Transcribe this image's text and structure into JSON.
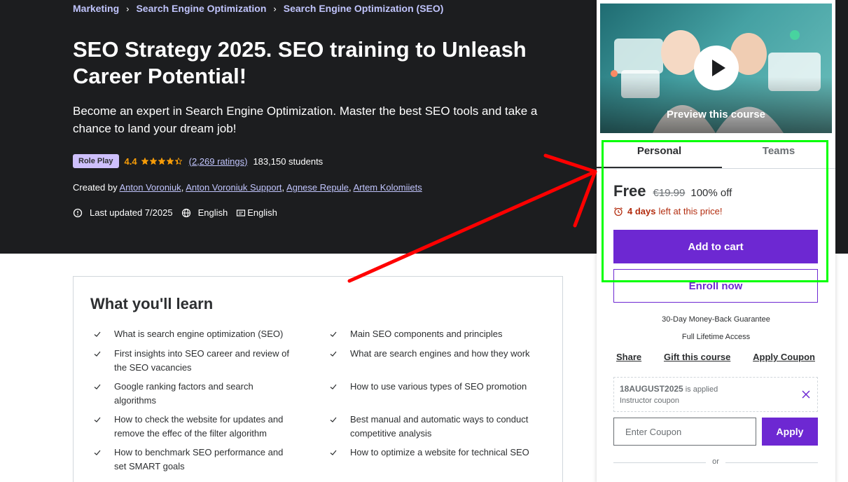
{
  "breadcrumb": [
    "Marketing",
    "Search Engine Optimization",
    "Search Engine Optimization (SEO)"
  ],
  "course": {
    "title": "SEO Strategy 2025. SEO training to Unleash Career Potential!",
    "subtitle": "Become an expert in Search Engine Optimization. Master the best SEO tools and take a chance to land your dream job!",
    "badge": "Role Play",
    "rating": "4.4",
    "stars_value": 4.4,
    "ratings_count": "(2,269 ratings)",
    "students": "183,150 students",
    "created_by_label": "Created by",
    "authors": [
      "Anton Voroniuk",
      "Anton Voroniuk Support",
      "Agnese Repule",
      "Artem Kolomiiets"
    ],
    "last_updated": "Last updated 7/2025",
    "language": "English",
    "captions": "English"
  },
  "learn": {
    "title": "What you'll learn",
    "left": [
      "What is search engine optimization (SEO)",
      "First insights into SEO career and review of the SEO vacancies",
      "Google ranking factors and search algorithms",
      "How to check the website for updates and remove the effec of the filter algorithm",
      "How to benchmark SEO performance and set SMART goals"
    ],
    "right": [
      "Main SEO components and principles",
      "What are search engines and how they work",
      "How to use various types of SEO promotion",
      "Best manual and automatic ways to conduct competitive analysis",
      "How to optimize a website for technical SEO"
    ]
  },
  "sidebar": {
    "preview_label": "Preview this course",
    "tabs": [
      "Personal",
      "Teams"
    ],
    "price": "Free",
    "original_price": "€19.99",
    "discount": "100% off",
    "deadline_bold": "4 days",
    "deadline_rest": "left at this price!",
    "add_to_cart": "Add to cart",
    "enroll_now": "Enroll now",
    "guarantee": "30-Day Money-Back Guarantee",
    "lifetime": "Full Lifetime Access",
    "links": [
      "Share",
      "Gift this course",
      "Apply Coupon"
    ],
    "coupon_code": "18AUGUST2025",
    "coupon_applied": "is applied",
    "coupon_type": "Instructor coupon",
    "coupon_placeholder": "Enter Coupon",
    "apply": "Apply",
    "or": "or"
  },
  "colors": {
    "hero_bg": "#1c1d1f",
    "accent_purple": "#6d28d2",
    "link_lavender": "#c0c4fc",
    "rating_orange": "#f69c08",
    "deadline_red": "#b32d0f",
    "annotation_green": "#00ff00",
    "annotation_red": "#ff0000"
  }
}
